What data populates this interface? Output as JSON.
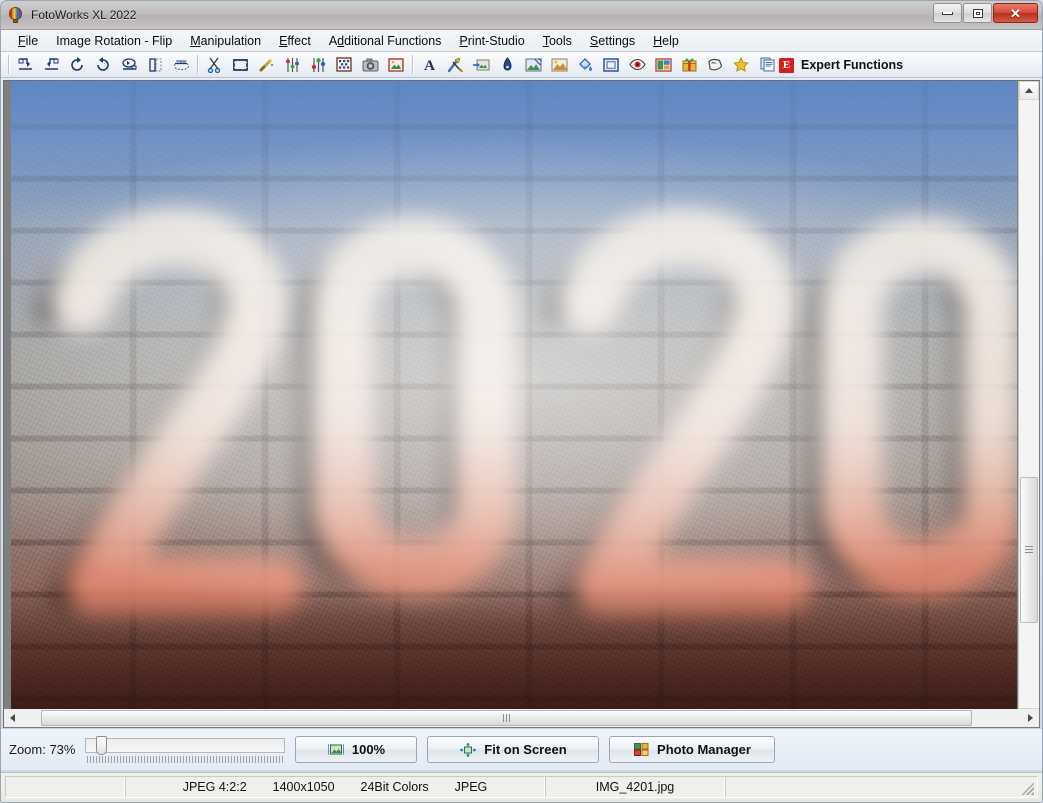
{
  "window": {
    "title": "FotoWorks XL 2022",
    "app_icon": "hot-air-balloon-icon",
    "buttons": {
      "minimize": "minimize-icon",
      "maximize": "restore-icon",
      "close": "✕"
    }
  },
  "menubar": {
    "items": [
      {
        "label": "File",
        "accel": "F"
      },
      {
        "label": "Image Rotation - Flip",
        "accel": "g"
      },
      {
        "label": "Manipulation",
        "accel": "M"
      },
      {
        "label": "Effect",
        "accel": "E"
      },
      {
        "label": "Additional Functions",
        "accel": "d"
      },
      {
        "label": "Print-Studio",
        "accel": "P"
      },
      {
        "label": "Tools",
        "accel": "T"
      },
      {
        "label": "Settings",
        "accel": "S"
      },
      {
        "label": "Help",
        "accel": "H"
      }
    ]
  },
  "toolbar": {
    "groups": [
      [
        "rotate-left-icon",
        "rotate-right-icon",
        "rotate-ccw-icon",
        "rotate-cw-icon",
        "flip-horizontal-icon",
        "flip-vertical-icon",
        "perspective-icon"
      ],
      [
        "scissors-crop-icon",
        "crop-frame-icon",
        "magic-wand-icon",
        "levels-icon",
        "color-balance-icon",
        "mosaic-icon",
        "camera-icon",
        "photo-frame-icon"
      ],
      [
        "text-tool-icon",
        "retouch-brush-icon",
        "image-export-icon",
        "ink-pen-icon",
        "image-measure-icon",
        "image-enhance-icon",
        "paint-bucket-icon",
        "border-icon",
        "red-eye-icon",
        "collage-icon",
        "gift-icon",
        "mask-icon",
        "favorite-star-icon",
        "batch-icon"
      ]
    ],
    "expert": {
      "badge": "E",
      "label": "Expert Functions"
    }
  },
  "canvas": {
    "image_description": "Blurred graffiti 2020 painted on a brick wall with blue sky",
    "scrollbars": {
      "vertical_thumb_position": "lower",
      "horizontal_thumb_position": "nearly-full-width"
    }
  },
  "zoombar": {
    "zoom_label": "Zoom: 73%",
    "zoom_value": 73,
    "slider_min": 1,
    "slider_max": 1000,
    "buttons": [
      {
        "id": "zoom-100",
        "label": "100%",
        "icon": "fit-actual-size-icon"
      },
      {
        "id": "fit-on-screen",
        "label": "Fit on Screen",
        "icon": "fit-screen-icon"
      },
      {
        "id": "photo-manager",
        "label": "Photo Manager",
        "icon": "grid-tiles-icon"
      }
    ]
  },
  "statusbar": {
    "format": "JPEG  4:2:2",
    "dimensions": "1400x1050",
    "colors": "24Bit Colors",
    "type": "JPEG",
    "filename": "IMG_4201.jpg"
  },
  "colors": {
    "accent_red": "#d61f1f",
    "titlebar": "#c0bcbd",
    "toolbar_bg": "#eef2f6",
    "close_button": "#d64a38"
  }
}
